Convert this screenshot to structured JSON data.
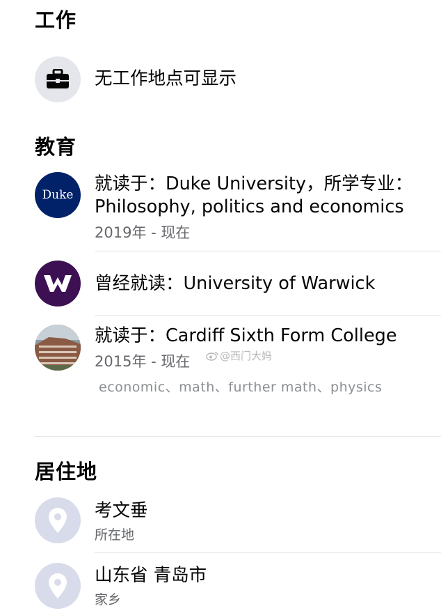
{
  "work": {
    "title": "工作",
    "empty_text": "无工作地点可显示",
    "icon": "briefcase-icon"
  },
  "education": {
    "title": "教育",
    "items": [
      {
        "line1": "就读于：Duke University，所学专业：",
        "line2": "Philosophy, politics and economics",
        "years": "2019年 - 现在",
        "logo_text": "Duke",
        "logo_color": "#012169"
      },
      {
        "line1": "曾经就读：University of Warwick",
        "logo_color": "#3c1053"
      },
      {
        "line1": "就读于：Cardiff Sixth Form College",
        "years": "2015年 - 现在",
        "tags": "economic、math、further math、physics"
      }
    ]
  },
  "watermark": "@西门大妈",
  "residence": {
    "title": "居住地",
    "items": [
      {
        "name": "考文垂",
        "type": "所在地"
      },
      {
        "name": "山东省 青岛市",
        "type": "家乡"
      }
    ]
  },
  "colors": {
    "icon_circle_bg": "#e4e6eb",
    "pin_circle_bg": "#d8dcea",
    "secondary_text": "#65676b"
  }
}
